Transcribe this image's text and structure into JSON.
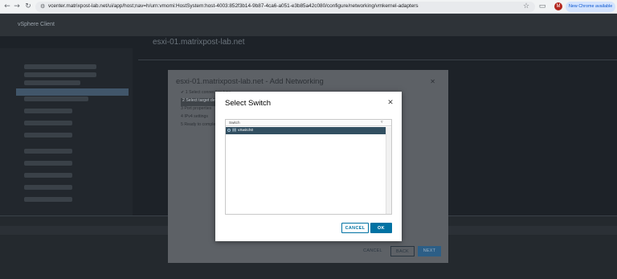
{
  "browser": {
    "url": "vcenter.matrixpost-lab.net/ui/app/host;nav=h/urn:vmomi:HostSystem:host-4003:852f3b14-9b87-4ca6-a051-e3b85a42c080/configure/networking/vmkernel-adapters",
    "profile_initial": "M",
    "update_label": "New Chrome available"
  },
  "vsphere": {
    "app_title": "vSphere Client",
    "host_title": "esxi-01.matrixpost-lab.net"
  },
  "wizard": {
    "title": "esxi-01.matrixpost-lab.net - Add Networking",
    "steps": [
      "✔ 1 Select connection type",
      "2 Select target device",
      "3 Port properties",
      "4 IPv4 settings",
      "5 Ready to complete"
    ],
    "cancel_label": "CANCEL",
    "back_label": "BACK",
    "next_label": "NEXT"
  },
  "modal": {
    "title": "Select Switch",
    "column_header": "Switch",
    "rows": [
      {
        "name": "vSwitch0",
        "selected": true
      }
    ],
    "cancel_label": "CANCEL",
    "ok_label": "OK"
  },
  "colors": {
    "accent": "#0072a3",
    "selected_row": "#324f61"
  }
}
